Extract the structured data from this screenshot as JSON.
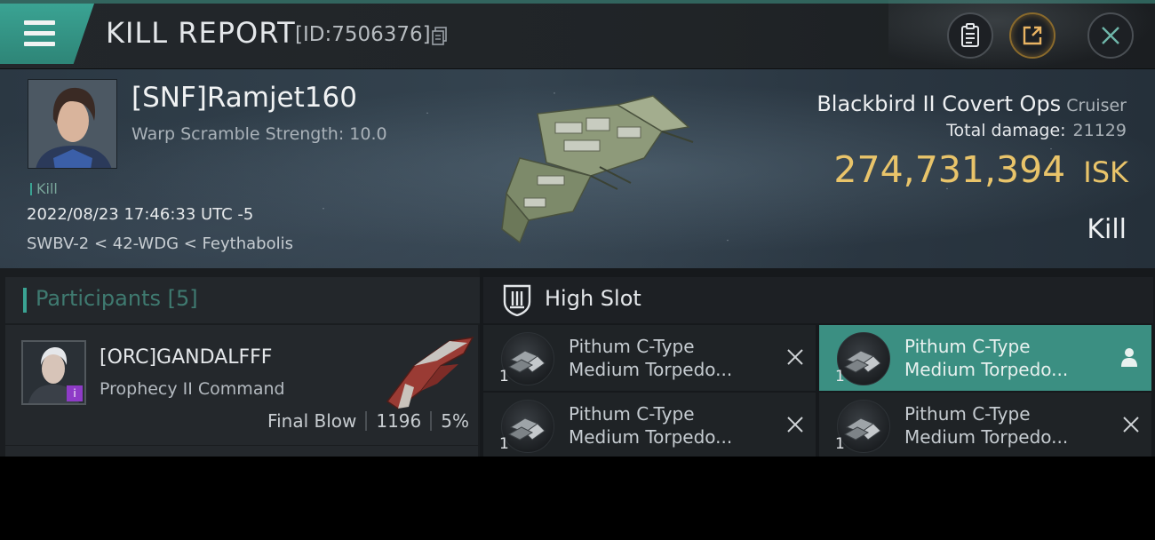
{
  "header": {
    "title": "KILL REPORT",
    "kill_id": "[ID:7506376]"
  },
  "victim": {
    "pilot_name": "[SNF]Ramjet160",
    "warp_scramble": "Warp Scramble Strength: 10.0",
    "kill_tag": "Kill",
    "datetime": "2022/08/23 17:46:33 UTC -5",
    "location": "SWBV-2 < 42-WDG < Feythabolis",
    "ship_name": "Blackbird II Covert Ops",
    "ship_class": "Cruiser",
    "damage_label": "Total damage:",
    "damage_value": "21129",
    "isk_value": "274,731,394",
    "isk_unit": "ISK",
    "kill_type": "Kill"
  },
  "participants": {
    "label": "Participants [5]",
    "items": [
      {
        "name": "[ORC]GANDALFFF",
        "ship": "Prophecy II Command",
        "final_blow_label": "Final Blow",
        "damage": "1196",
        "percent": "5%",
        "badge": "i"
      }
    ]
  },
  "high_slot": {
    "label": "High Slot",
    "modules": [
      {
        "line1": "Pithum C-Type",
        "line2": "Medium Torpedo...",
        "qty": "1",
        "state": "destroyed"
      },
      {
        "line1": "Pithum C-Type",
        "line2": "Medium Torpedo...",
        "qty": "1",
        "state": "dropped"
      },
      {
        "line1": "Pithum C-Type",
        "line2": "Medium Torpedo...",
        "qty": "1",
        "state": "destroyed"
      },
      {
        "line1": "Pithum C-Type",
        "line2": "Medium Torpedo...",
        "qty": "1",
        "state": "destroyed"
      }
    ]
  },
  "colors": {
    "accent": "#3aa393",
    "isk": "#e9c46a",
    "badge": "#8e3bc7"
  },
  "icons": [
    "menu-icon",
    "copy-icon",
    "clipboard-icon",
    "share-icon",
    "close-icon",
    "high-slot-icon",
    "module-icon",
    "destroyed-x-icon",
    "person-icon"
  ]
}
